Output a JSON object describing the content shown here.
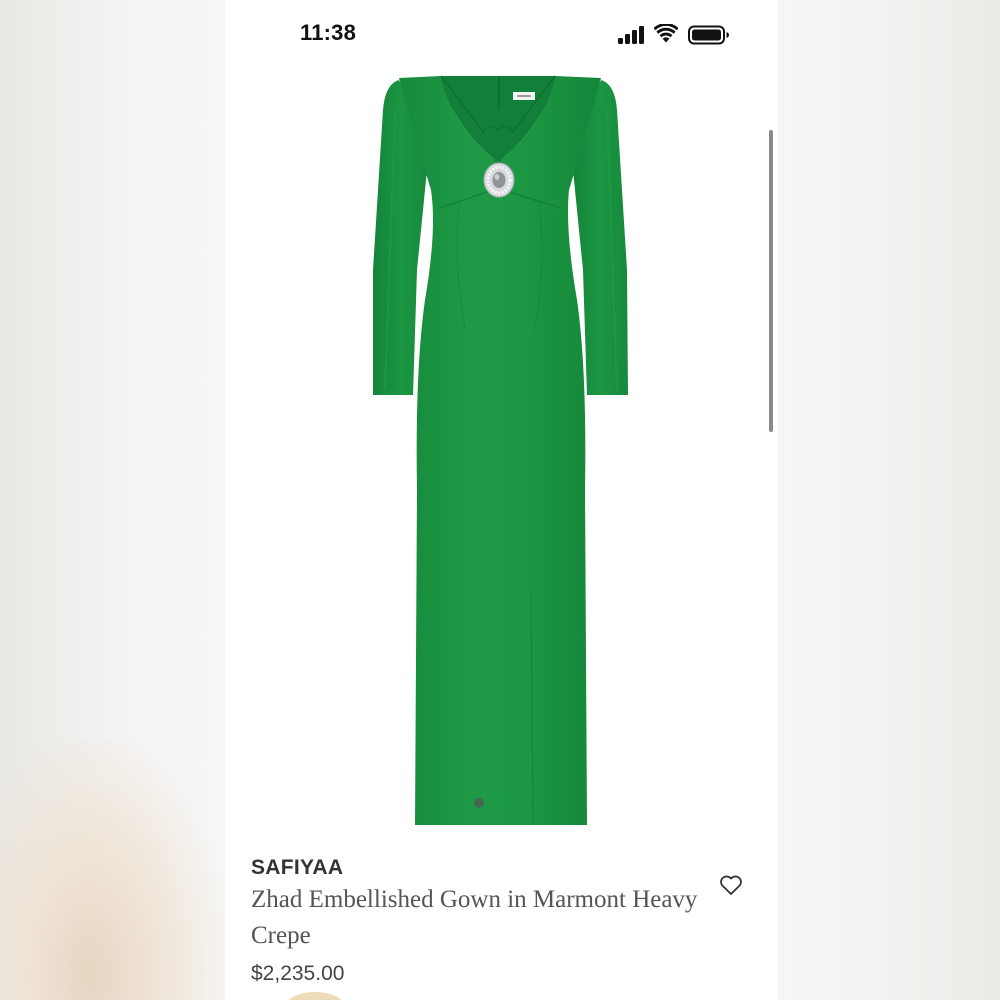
{
  "status_bar": {
    "time": "11:38",
    "signal_icon": "cellular-signal-icon",
    "wifi_icon": "wifi-icon",
    "battery_icon": "battery-icon"
  },
  "product": {
    "image": "green-long-sleeve-gown-with-crystal-brooch",
    "brand": "SAFIYAA",
    "name": "Zhad Embellished Gown in Marmont Heavy Crepe",
    "price": "$2,235.00",
    "wishlist_icon": "heart-icon"
  },
  "colors": {
    "gown_green": "#1c9442",
    "text_dark": "#333333",
    "text_muted": "#555555"
  }
}
